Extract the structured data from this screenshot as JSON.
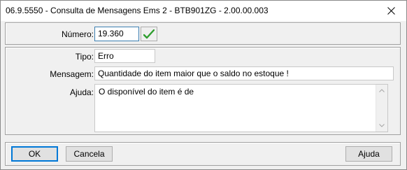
{
  "window": {
    "title": "06.9.5550 - Consulta de Mensagens Ems 2 - BTB901ZG - 2.00.00.003",
    "close_icon": "close-icon"
  },
  "top_panel": {
    "numero_label": "Número:",
    "numero_value": "19.360",
    "confirm_icon": "checkmark-icon"
  },
  "detail_panel": {
    "tipo_label": "Tipo:",
    "tipo_value": "Erro",
    "mensagem_label": "Mensagem:",
    "mensagem_value": "Quantidade do item  maior que o saldo no estoque !",
    "ajuda_label": "Ajuda:",
    "ajuda_value": "O disponível do item  é de"
  },
  "buttons": {
    "ok": "OK",
    "cancela": "Cancela",
    "ajuda": "Ajuda"
  },
  "colors": {
    "accent": "#0078d7",
    "check_green": "#2e9e2e"
  }
}
